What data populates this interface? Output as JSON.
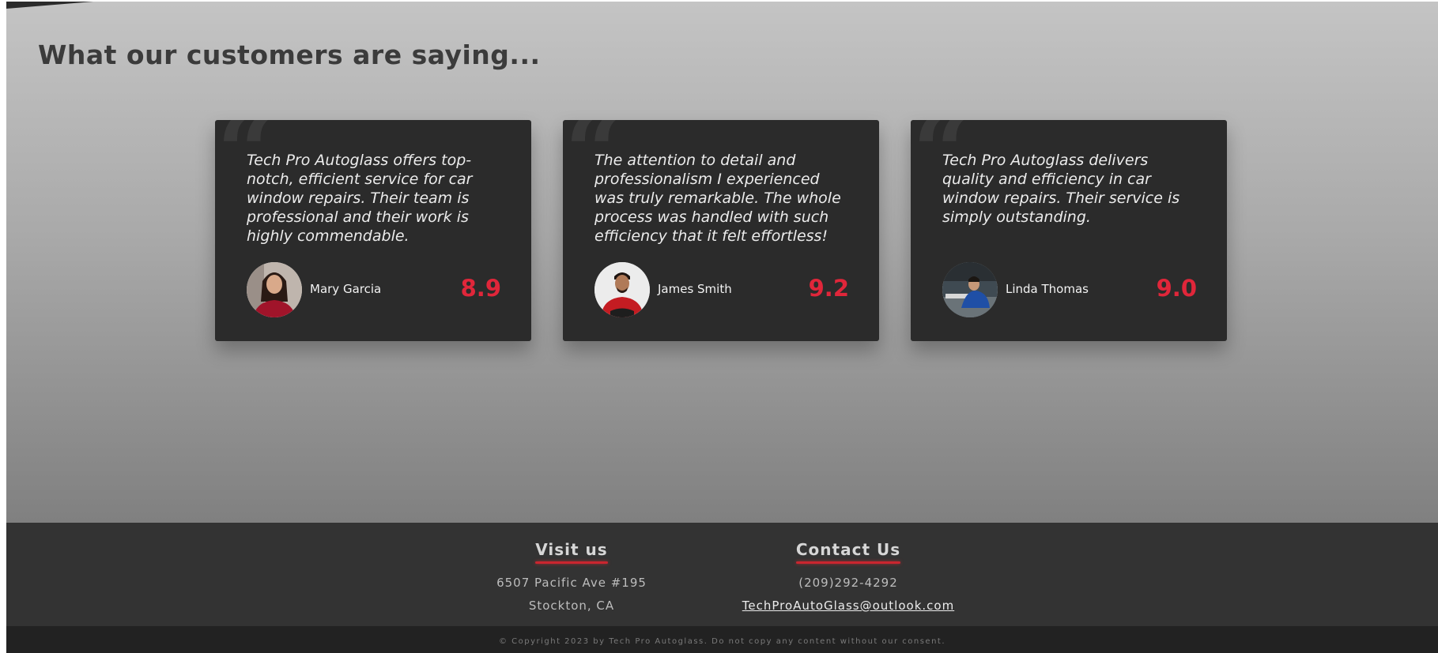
{
  "testimonials": {
    "title": "What our customers are saying...",
    "quote_glyph": "“",
    "cards": [
      {
        "quote": "Tech Pro Autoglass offers top-notch, efficient service for car window repairs. Their team is professional and their work is highly commendable.",
        "name": "Mary Garcia",
        "score": "8.9"
      },
      {
        "quote": "The attention to detail and professionalism I experienced was truly remarkable. The whole process was handled with such efficiency that it felt effortless!",
        "name": "James Smith",
        "score": "9.2"
      },
      {
        "quote": "Tech Pro Autoglass delivers quality and efficiency in car window repairs. Their service is simply outstanding.",
        "name": "Linda Thomas",
        "score": "9.0"
      }
    ]
  },
  "footer": {
    "visit": {
      "heading": "Visit us",
      "address_line1": "6507 Pacific Ave #195",
      "address_line2": "Stockton, CA"
    },
    "contact": {
      "heading": "Contact Us",
      "phone": "(209)292-4292",
      "email": "TechProAutoGlass@outlook.com"
    },
    "copyright": "© Copyright 2023 by Tech Pro Autoglass. Do not copy any content without our consent."
  },
  "colors": {
    "score_red": "#e0263a",
    "card_bg": "#2b2b2b",
    "footer_bg": "#333333",
    "accent_underline": "#c9262f"
  }
}
